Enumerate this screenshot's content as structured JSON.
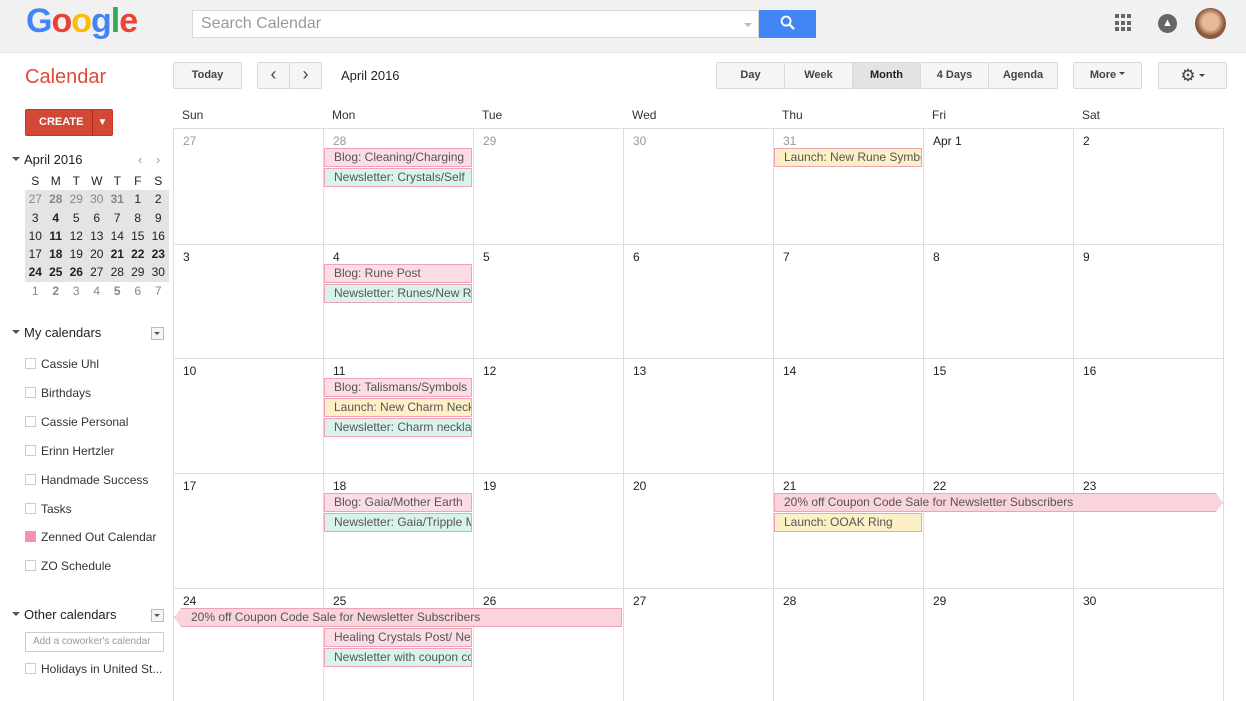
{
  "header": {
    "logo": "Google",
    "search_placeholder": "Search Calendar",
    "search_icon": "magnifier-icon",
    "apps_icon": "grid-icon",
    "notifications_icon": "bell-icon"
  },
  "toolbar": {
    "app_title": "Calendar",
    "today": "Today",
    "prev": "‹",
    "next": "›",
    "period": "April 2016",
    "views": [
      "Day",
      "Week",
      "Month",
      "4 Days",
      "Agenda"
    ],
    "selected_view": "Month",
    "more": "More",
    "settings_icon": "gear-icon"
  },
  "sidebar": {
    "create": "CREATE",
    "mini_title": "April 2016",
    "mini_dow": [
      "S",
      "M",
      "T",
      "W",
      "T",
      "F",
      "S"
    ],
    "mini_weeks": [
      [
        "27",
        "28",
        "29",
        "30",
        "31",
        "1",
        "2"
      ],
      [
        "3",
        "4",
        "5",
        "6",
        "7",
        "8",
        "9"
      ],
      [
        "10",
        "11",
        "12",
        "13",
        "14",
        "15",
        "16"
      ],
      [
        "17",
        "18",
        "19",
        "20",
        "21",
        "22",
        "23"
      ],
      [
        "24",
        "25",
        "26",
        "27",
        "28",
        "29",
        "30"
      ],
      [
        "1",
        "2",
        "3",
        "4",
        "5",
        "6",
        "7"
      ]
    ],
    "mini_bold": [
      "28",
      "31",
      "4",
      "11",
      "18",
      "21",
      "22",
      "23",
      "24",
      "25",
      "26",
      "2",
      "5"
    ],
    "my_calendars_label": "My calendars",
    "my_calendars": [
      {
        "name": "Cassie Uhl",
        "color": ""
      },
      {
        "name": "Birthdays",
        "color": ""
      },
      {
        "name": "Cassie Personal",
        "color": ""
      },
      {
        "name": "Erinn Hertzler",
        "color": ""
      },
      {
        "name": "Handmade Success",
        "color": ""
      },
      {
        "name": "Tasks",
        "color": ""
      },
      {
        "name": "Zenned Out Calendar",
        "color": "#f691b2"
      },
      {
        "name": "ZO Schedule",
        "color": ""
      }
    ],
    "other_calendars_label": "Other calendars",
    "coworker_placeholder": "Add a coworker's calendar",
    "other_calendars": [
      {
        "name": "Holidays in United St..."
      }
    ]
  },
  "month": {
    "dow": [
      "Sun",
      "Mon",
      "Tue",
      "Wed",
      "Thu",
      "Fri",
      "Sat"
    ],
    "weeks": [
      [
        "27",
        "28",
        "29",
        "30",
        "31",
        "Apr 1",
        "2"
      ],
      [
        "3",
        "4",
        "5",
        "6",
        "7",
        "8",
        "9"
      ],
      [
        "10",
        "11",
        "12",
        "13",
        "14",
        "15",
        "16"
      ],
      [
        "17",
        "18",
        "19",
        "20",
        "21",
        "22",
        "23"
      ],
      [
        "24",
        "25",
        "26",
        "27",
        "28",
        "29",
        "30"
      ]
    ],
    "colors": {
      "blog": "#fcdde5",
      "newsletter": "#d8f3ec",
      "launch": "#fdf0c7",
      "sale": "#f9d4da"
    },
    "events": [
      {
        "week": 0,
        "day": 1,
        "span": 1,
        "row": 0,
        "type": "blog",
        "title": "Blog: Cleaning/Charging"
      },
      {
        "week": 0,
        "day": 1,
        "span": 1,
        "row": 1,
        "type": "newsletter",
        "title": "Newsletter: Crystals/Self"
      },
      {
        "week": 0,
        "day": 4,
        "span": 1,
        "row": 0,
        "type": "launch",
        "title": "Launch: New Rune Symbols"
      },
      {
        "week": 1,
        "day": 1,
        "span": 1,
        "row": 0,
        "type": "blog",
        "title": "Blog: Rune Post"
      },
      {
        "week": 1,
        "day": 1,
        "span": 1,
        "row": 1,
        "type": "newsletter",
        "title": "Newsletter: Runes/New Rune"
      },
      {
        "week": 2,
        "day": 1,
        "span": 1,
        "row": 0,
        "type": "blog",
        "title": "Blog: Talismans/Symbols"
      },
      {
        "week": 2,
        "day": 1,
        "span": 1,
        "row": 1,
        "type": "launch",
        "title": "Launch: New Charm Necklaces"
      },
      {
        "week": 2,
        "day": 1,
        "span": 1,
        "row": 2,
        "type": "newsletter",
        "title": "Newsletter: Charm necklaces"
      },
      {
        "week": 3,
        "day": 1,
        "span": 1,
        "row": 0,
        "type": "blog",
        "title": "Blog: Gaia/Mother Earth"
      },
      {
        "week": 3,
        "day": 1,
        "span": 1,
        "row": 1,
        "type": "newsletter",
        "title": "Newsletter: Gaia/Tripple Moon"
      },
      {
        "week": 3,
        "day": 4,
        "span": 3,
        "row": 0,
        "type": "sale",
        "title": "20% off Coupon Code Sale for Newsletter Subscribers",
        "cont": "right"
      },
      {
        "week": 3,
        "day": 4,
        "span": 1,
        "row": 1,
        "type": "launch",
        "title": "Launch: OOAK Ring"
      },
      {
        "week": 4,
        "day": 0,
        "span": 3,
        "row": 0,
        "type": "sale",
        "title": "20% off Coupon Code Sale for Newsletter Subscribers",
        "cont": "left"
      },
      {
        "week": 4,
        "day": 1,
        "span": 1,
        "row": 1,
        "type": "blog",
        "title": "Healing Crystals Post/ New"
      },
      {
        "week": 4,
        "day": 1,
        "span": 1,
        "row": 2,
        "type": "newsletter",
        "title": "Newsletter with coupon code"
      }
    ]
  }
}
